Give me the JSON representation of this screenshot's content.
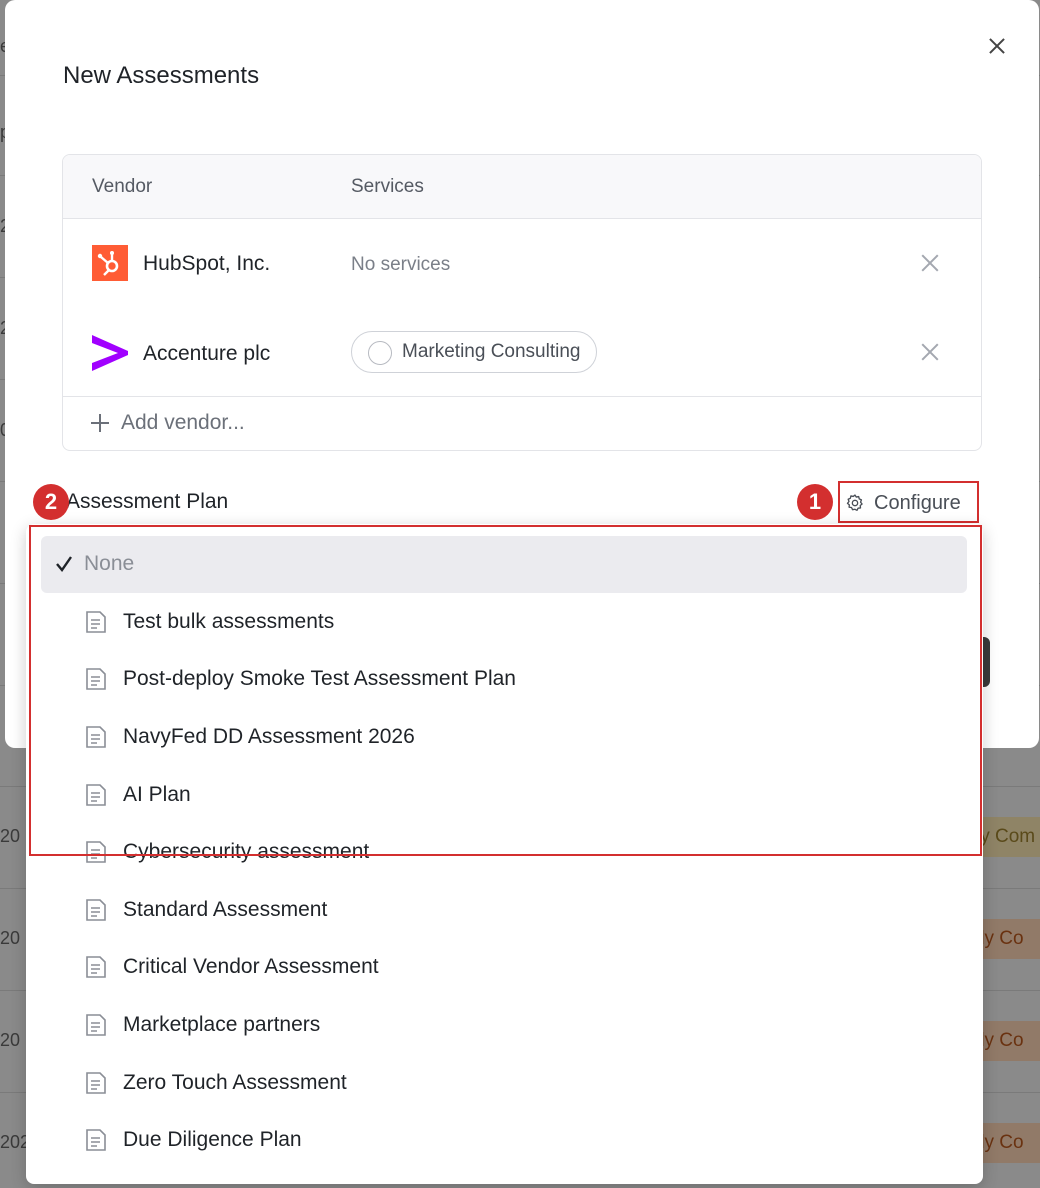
{
  "background": {
    "fragments": [
      "e",
      "p",
      "2",
      "2",
      "0",
      "20",
      "20",
      "20",
      "202"
    ],
    "badges": [
      {
        "text": "ly Com",
        "tone": "yellow"
      },
      {
        "text": "lly Co",
        "tone": "orange"
      },
      {
        "text": "lly Co",
        "tone": "orange"
      },
      {
        "text": "lly Co",
        "tone": "orange"
      }
    ]
  },
  "modal": {
    "title": "New Assessments",
    "table": {
      "col_vendor": "Vendor",
      "col_services": "Services",
      "rows": [
        {
          "vendor": "HubSpot, Inc.",
          "services": "No services",
          "logo": "hubspot-logo"
        },
        {
          "vendor": "Accenture plc",
          "service_pill": "Marketing Consulting",
          "logo": "accenture-logo"
        }
      ],
      "add_vendor": "Add vendor..."
    },
    "plan_label": "Assessment Plan",
    "configure_label": "Configure"
  },
  "annotations": {
    "one": "1",
    "two": "2",
    "color": "#d32f2f"
  },
  "dropdown": {
    "selected": "None",
    "items": [
      "Test bulk assessments",
      "Post-deploy Smoke Test Assessment Plan",
      "NavyFed DD Assessment 2026",
      "AI Plan",
      "Cybersecurity assessment",
      "Standard Assessment",
      "Critical Vendor Assessment",
      "Marketplace partners",
      "Zero Touch Assessment",
      "Due Diligence Plan"
    ]
  },
  "colors": {
    "hubspot": "#ff5c35",
    "accenture": "#a100ff",
    "highlight": "#d32f2f"
  }
}
